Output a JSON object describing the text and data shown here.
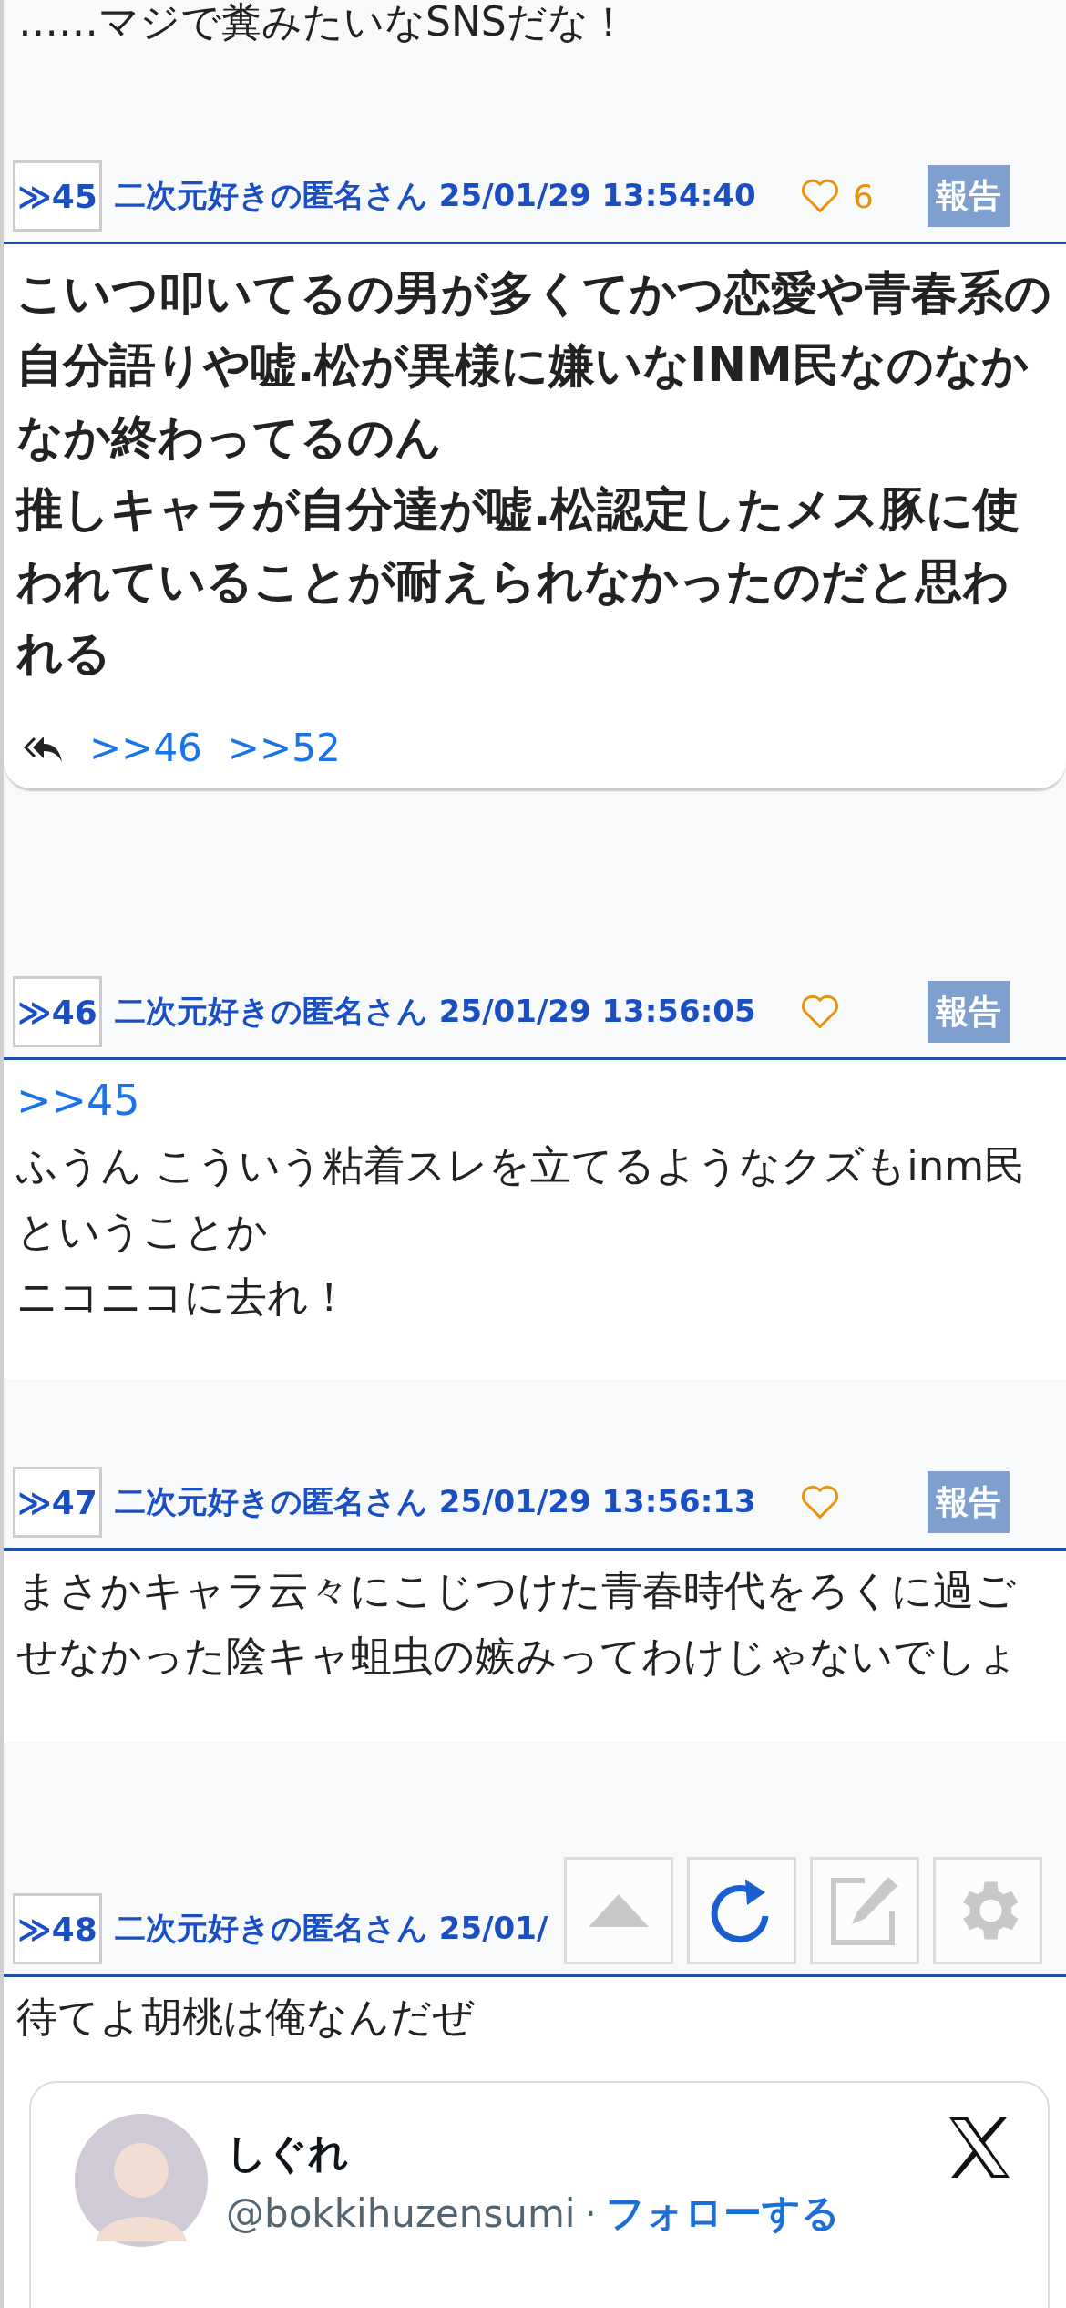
{
  "previous_post": {
    "lines": [
      "……マジで糞みたいなSNSだな！"
    ]
  },
  "posts": [
    {
      "number": "≫45",
      "meta": "二次元好きの匿名さん 25/01/29 13:54:40",
      "likes": "6",
      "report": "報告",
      "kind": "emphasis",
      "paragraphs": [
        "こいつ叩いてるの男が多くてかつ恋愛や青春系の自分語りや嘘.松が異様に嫌いなINM民なのなかなか終わってるのん",
        "推しキャラが自分達が嘘.松認定したメス豚に使われていることが耐えられなかったのだと思われる"
      ],
      "replies": [
        ">>46",
        ">>52"
      ]
    },
    {
      "number": "≫46",
      "meta": "二次元好きの匿名さん 25/01/29 13:56:05",
      "report": "報告",
      "kind": "normal",
      "anchor": ">>45",
      "paragraphs": [
        "ふうん こういう粘着スレを立てるようなクズもinm民ということか",
        "ニコニコに去れ！"
      ]
    },
    {
      "number": "≫47",
      "meta": "二次元好きの匿名さん 25/01/29 13:56:13",
      "report": "報告",
      "kind": "normal",
      "paragraphs": [
        "まさかキャラ云々にこじつけた青春時代をろくに過ごせなかった陰キャ蛆虫の嫉みってわけじゃないでしょ"
      ]
    },
    {
      "number": "≫48",
      "meta": "二次元好きの匿名さん 25/01/",
      "kind": "normal",
      "paragraphs": [
        "待てよ胡桃は俺なんだぜ"
      ],
      "embed": {
        "name": "しぐれ",
        "handle": "@bokkihuzensumi",
        "separator": "·",
        "follow": "フォローする"
      }
    }
  ],
  "toolbar": [
    {
      "kind": "up",
      "disabled": true
    },
    {
      "kind": "refresh",
      "disabled": false
    },
    {
      "kind": "edit",
      "disabled": true
    },
    {
      "kind": "settings",
      "disabled": true
    }
  ]
}
